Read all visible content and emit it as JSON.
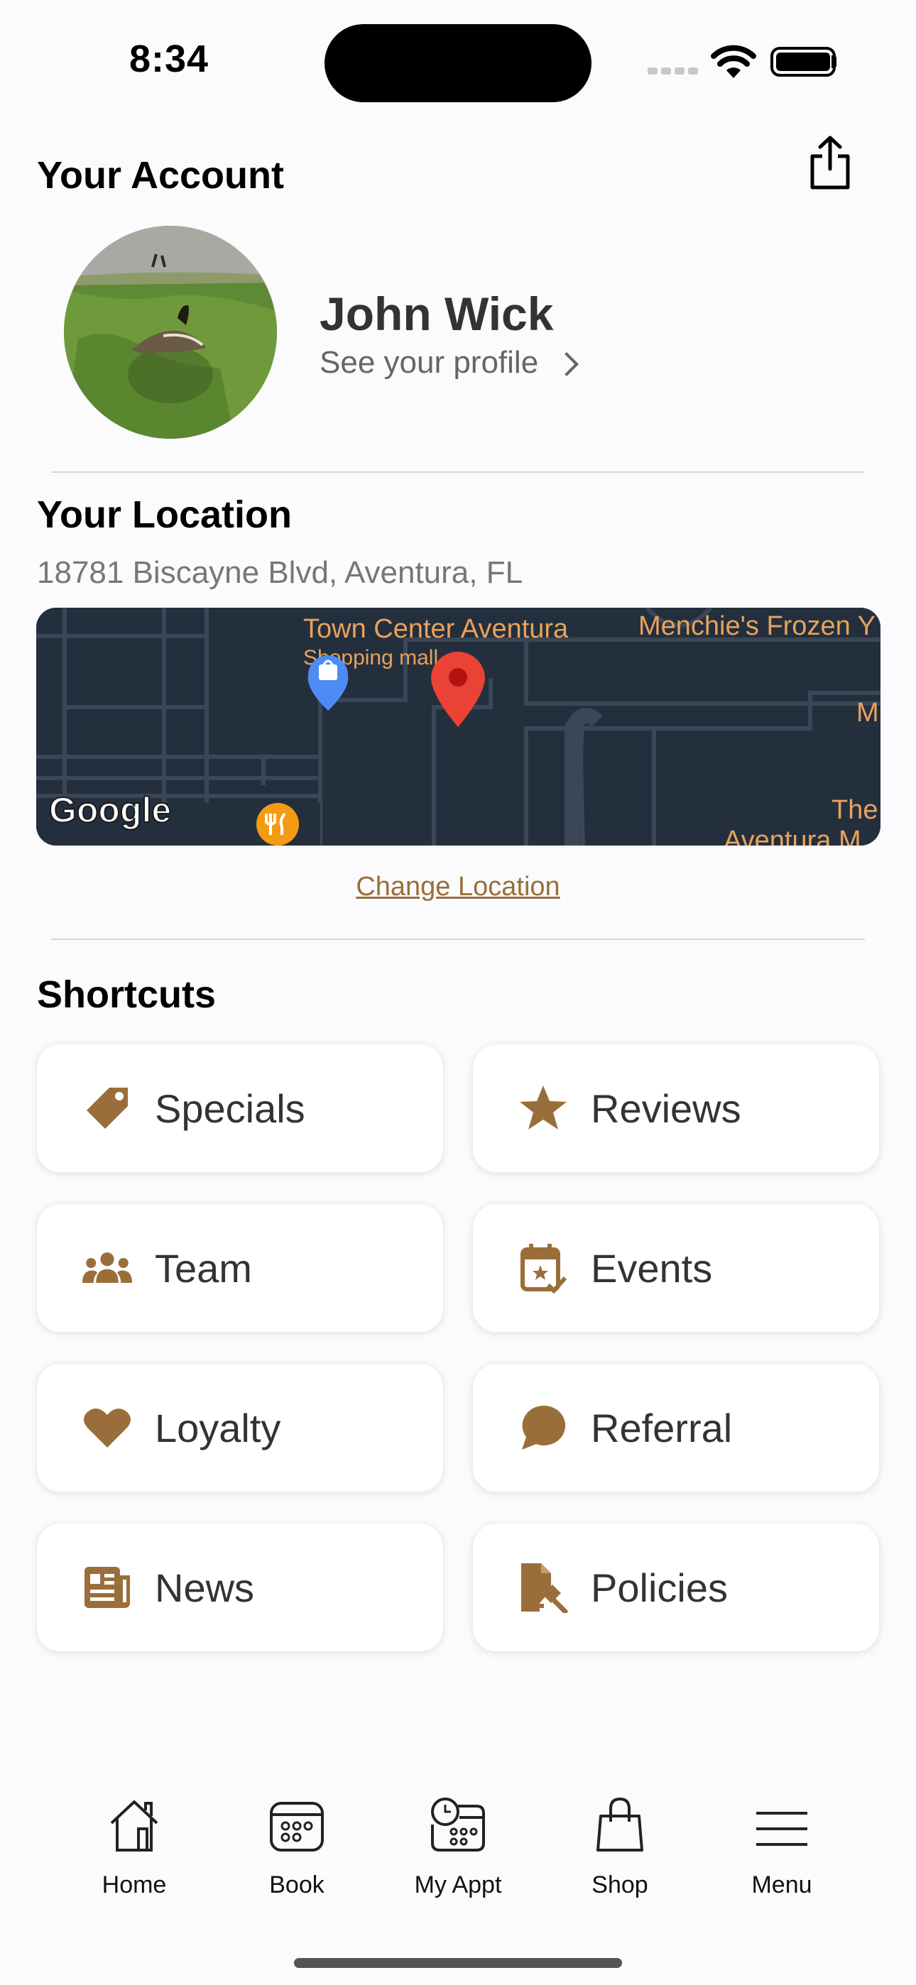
{
  "status_bar": {
    "time": "8:34"
  },
  "account": {
    "title": "Your Account",
    "user_name": "John Wick",
    "profile_link": "See your profile"
  },
  "location": {
    "title": "Your Location",
    "address": "18781 Biscayne Blvd, Aventura, FL",
    "map": {
      "labels": [
        "Town Center Aventura",
        "Shopping mall",
        "Menchie's Frozen Y",
        "M",
        "The",
        "Aventura M"
      ],
      "attribution": "Google"
    },
    "change_label": "Change Location"
  },
  "shortcuts": {
    "title": "Shortcuts",
    "items": [
      {
        "label": "Specials",
        "icon": "tag-icon"
      },
      {
        "label": "Reviews",
        "icon": "star-icon"
      },
      {
        "label": "Team",
        "icon": "team-icon"
      },
      {
        "label": "Events",
        "icon": "calendar-check-icon"
      },
      {
        "label": "Loyalty",
        "icon": "heart-icon"
      },
      {
        "label": "Referral",
        "icon": "chat-bubble-icon"
      },
      {
        "label": "News",
        "icon": "newspaper-icon"
      },
      {
        "label": "Policies",
        "icon": "document-gavel-icon"
      }
    ]
  },
  "tab_bar": {
    "items": [
      {
        "label": "Home",
        "icon": "home-icon"
      },
      {
        "label": "Book",
        "icon": "calendar-grid-icon"
      },
      {
        "label": "My Appt",
        "icon": "appointment-icon"
      },
      {
        "label": "Shop",
        "icon": "shopping-bag-icon"
      },
      {
        "label": "Menu",
        "icon": "hamburger-menu-icon"
      }
    ]
  },
  "colors": {
    "accent": "#9a6e3a",
    "map_bg": "#242f3e",
    "map_text": "#e8a25c",
    "pin": "#ea4335"
  }
}
